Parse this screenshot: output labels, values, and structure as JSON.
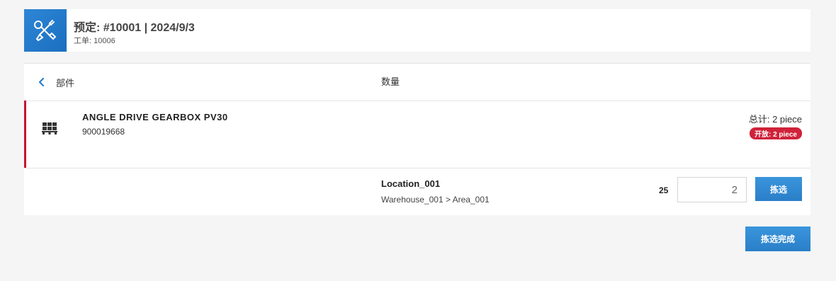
{
  "header": {
    "title": "预定: #10001 | 2024/9/3",
    "work_order": "工单: 10006",
    "icon": "tools-icon",
    "accent_color": "#2a7fc8"
  },
  "table": {
    "col_part": "部件",
    "col_quantity": "数量"
  },
  "item": {
    "name": "ANGLE DRIVE GEARBOX PV30",
    "code": "900019668",
    "total": "总计: 2 piece",
    "open_badge": "开放: 2 piece",
    "badge_color": "#d0223a",
    "icon": "pallet-icon"
  },
  "location": {
    "name": "Location_001",
    "path": "Warehouse_001 > Area_001",
    "available": "25",
    "quantity_value": "2",
    "pick_label": "拣选"
  },
  "footer": {
    "done_label": "拣选完成"
  }
}
